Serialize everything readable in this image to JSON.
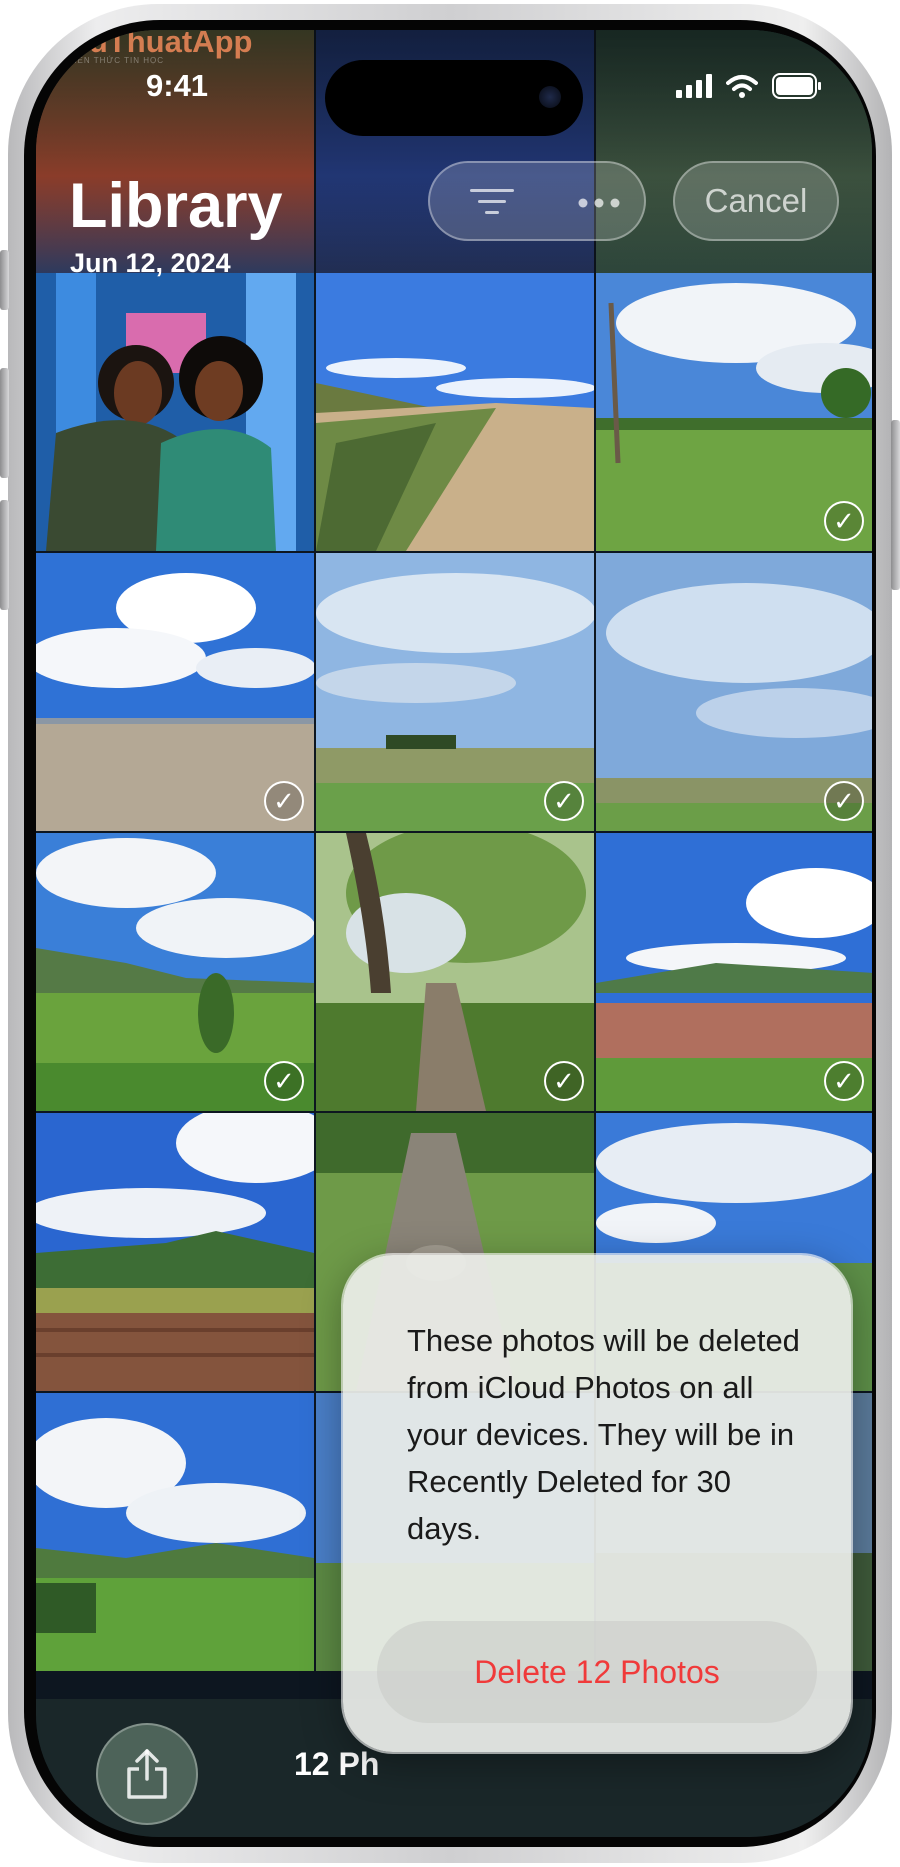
{
  "watermark": {
    "brand": "ThuThuatApp",
    "tagline": "KIẾN THỨC TIN HỌC"
  },
  "status_bar": {
    "time": "9:41"
  },
  "header": {
    "title": "Library",
    "date": "Jun 12, 2024",
    "cancel_label": "Cancel"
  },
  "icons": {
    "filter": "filter-lines-icon",
    "more": "ellipsis-icon",
    "share": "share-icon",
    "check": "checkmark-icon",
    "signal": "cellular-signal-icon",
    "wifi": "wifi-icon",
    "battery": "battery-icon"
  },
  "grid": {
    "photos": [
      {
        "subject": "selfie",
        "selected": false
      },
      {
        "subject": "sandy-path",
        "selected": false
      },
      {
        "subject": "meadow-tree",
        "selected": true
      },
      {
        "subject": "beach-sky",
        "selected": true
      },
      {
        "subject": "field-sky",
        "selected": true
      },
      {
        "subject": "field-sky-2",
        "selected": true
      },
      {
        "subject": "hills-field",
        "selected": true
      },
      {
        "subject": "forest-path",
        "selected": true
      },
      {
        "subject": "red-field",
        "selected": true
      },
      {
        "subject": "hill-farmland",
        "selected": true
      },
      {
        "subject": "trail-stones",
        "selected": true
      },
      {
        "subject": "shore-clouds",
        "selected": true
      },
      {
        "subject": "green-hills",
        "selected": false
      }
    ]
  },
  "bottom_bar": {
    "count_label": "12 Ph"
  },
  "dialog": {
    "message": "These photos will be deleted from iCloud Photos on all your devices. They will be in Recently Deleted for 30 days.",
    "delete_label": "Delete 12 Photos"
  },
  "colors": {
    "destructive": "#F03A3A",
    "sky": "#2F72D6",
    "grass": "#5E9A3C"
  }
}
